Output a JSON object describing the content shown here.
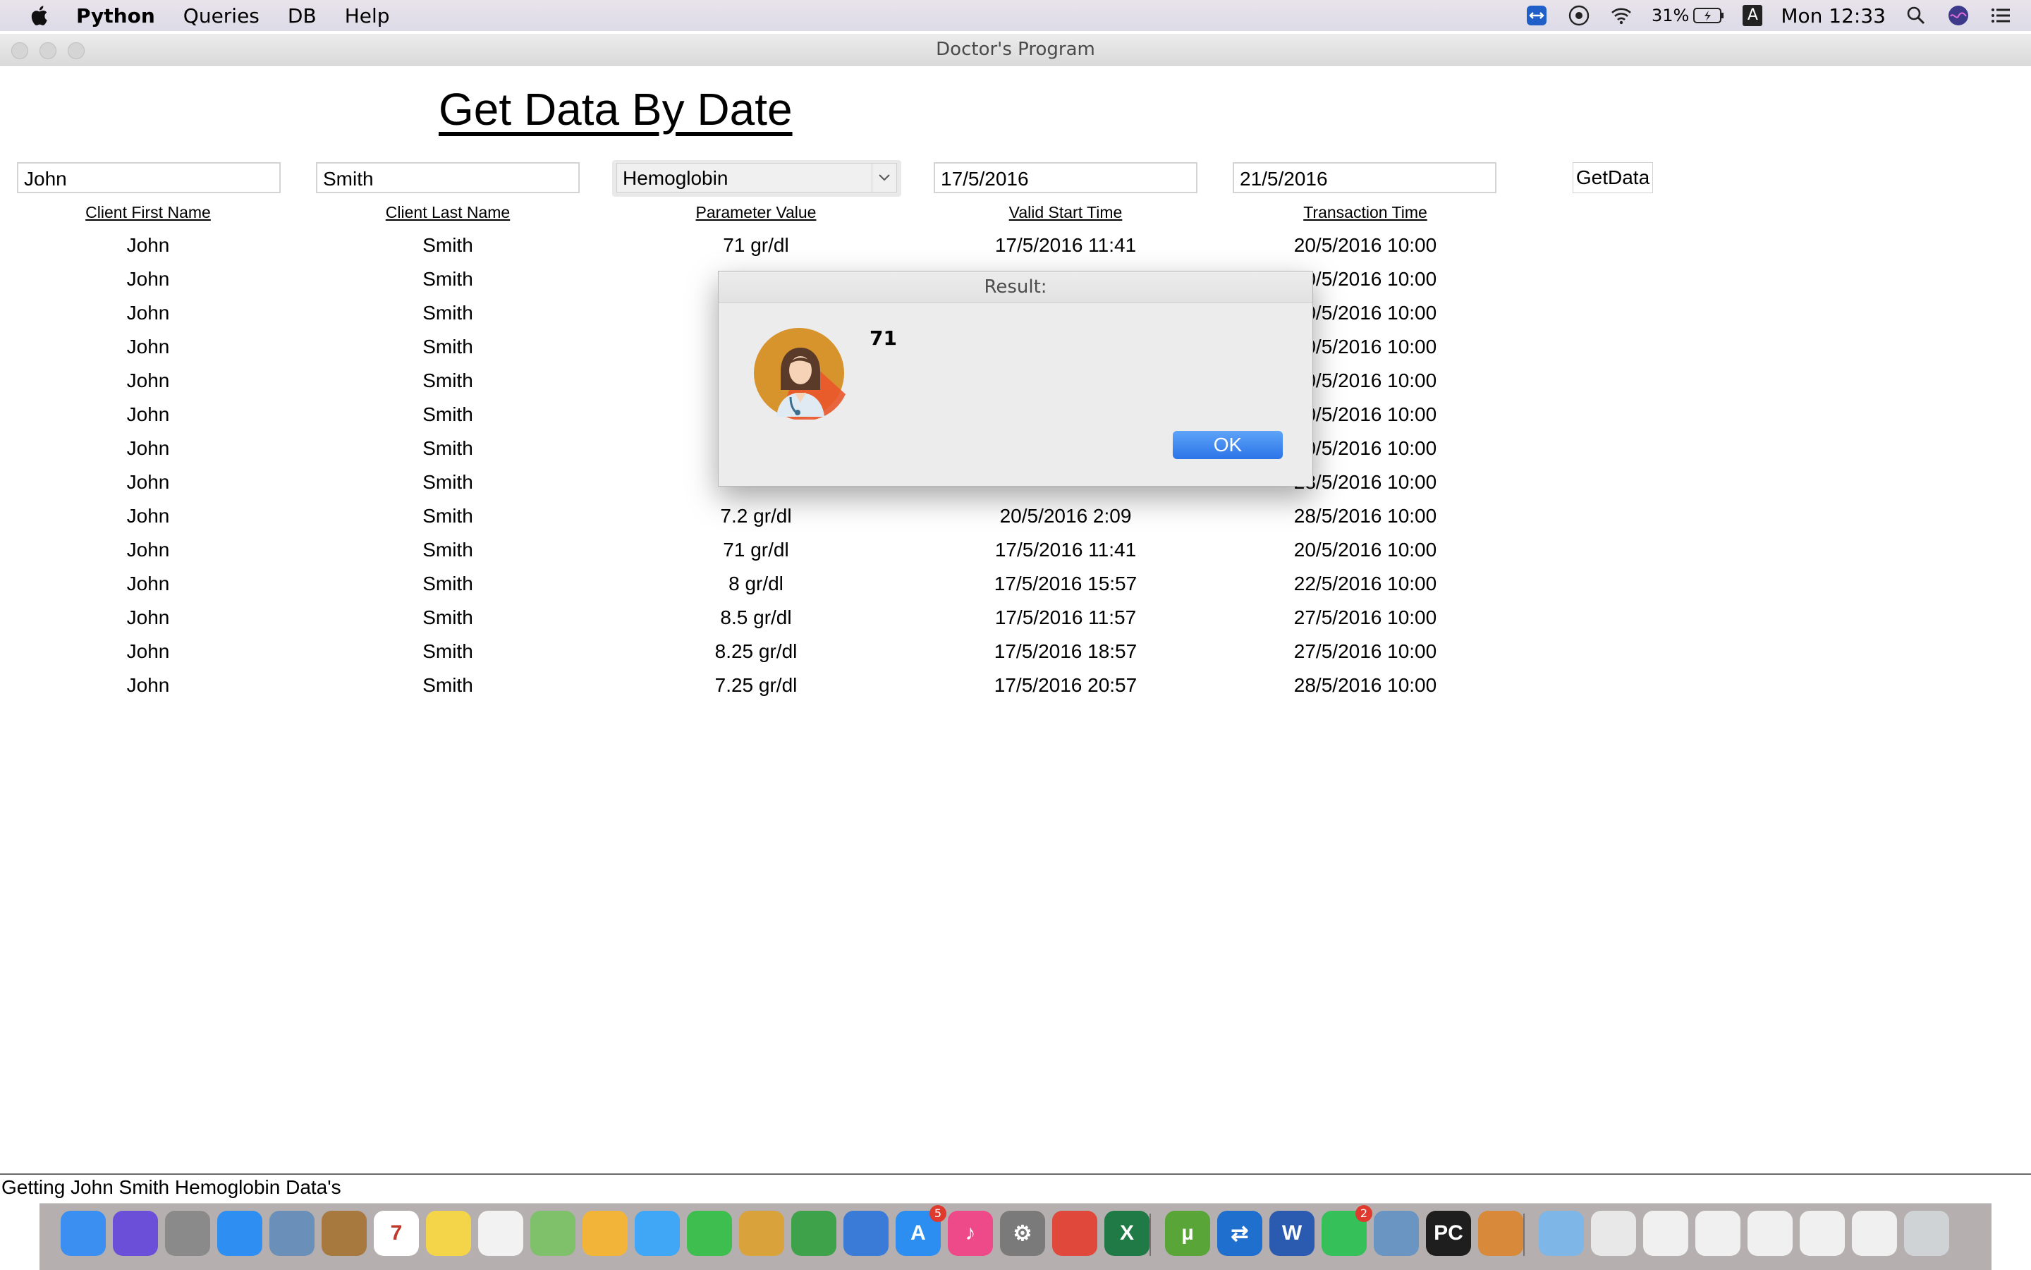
{
  "menubar": {
    "app_name": "Python",
    "items": [
      "Queries",
      "DB",
      "Help"
    ],
    "battery": "31%",
    "input_indicator": "A",
    "clock": "Mon 12:33"
  },
  "window": {
    "title": "Doctor's Program"
  },
  "page": {
    "heading": "Get Data By Date"
  },
  "form": {
    "first_name": "John",
    "last_name": "Smith",
    "parameter": "Hemoglobin",
    "start_date": "17/5/2016",
    "end_date": "21/5/2016",
    "button": "GetData"
  },
  "table": {
    "headers": [
      "Client First Name",
      "Client Last Name",
      "Parameter Value",
      "Valid Start Time",
      "Transaction Time"
    ],
    "rows": [
      [
        "John",
        "Smith",
        "71 gr/dl",
        "17/5/2016 11:41",
        "20/5/2016 10:00"
      ],
      [
        "John",
        "Smith",
        "",
        "",
        "20/5/2016 10:00"
      ],
      [
        "John",
        "Smith",
        "",
        "",
        "20/5/2016 10:00"
      ],
      [
        "John",
        "Smith",
        "",
        "",
        "20/5/2016 10:00"
      ],
      [
        "John",
        "Smith",
        "",
        "",
        "20/5/2016 10:00"
      ],
      [
        "John",
        "Smith",
        "",
        "",
        "20/5/2016 10:00"
      ],
      [
        "John",
        "Smith",
        "",
        "",
        "20/5/2016 10:00"
      ],
      [
        "John",
        "Smith",
        "",
        "",
        "28/5/2016 10:00"
      ],
      [
        "John",
        "Smith",
        "7.2 gr/dl",
        "20/5/2016 2:09",
        "28/5/2016 10:00"
      ],
      [
        "John",
        "Smith",
        "71 gr/dl",
        "17/5/2016 11:41",
        "20/5/2016 10:00"
      ],
      [
        "John",
        "Smith",
        "8 gr/dl",
        "17/5/2016 15:57",
        "22/5/2016 10:00"
      ],
      [
        "John",
        "Smith",
        "8.5 gr/dl",
        "17/5/2016 11:57",
        "27/5/2016 10:00"
      ],
      [
        "John",
        "Smith",
        "8.25 gr/dl",
        "17/5/2016 18:57",
        "27/5/2016 10:00"
      ],
      [
        "John",
        "Smith",
        "7.25 gr/dl",
        "17/5/2016 20:57",
        "28/5/2016 10:00"
      ]
    ]
  },
  "dialog": {
    "title": "Result:",
    "message": "71",
    "ok_label": "OK",
    "icon": "doctor-avatar-icon"
  },
  "status": {
    "text": "Getting John Smith Hemoglobin Data's"
  },
  "dock": {
    "apps": [
      {
        "name": "finder",
        "color": "#3b8ff0",
        "glyph": ""
      },
      {
        "name": "siri",
        "color": "#6b4fd8",
        "glyph": ""
      },
      {
        "name": "launchpad",
        "color": "#8a8a8a",
        "glyph": ""
      },
      {
        "name": "safari",
        "color": "#2f8ef2",
        "glyph": ""
      },
      {
        "name": "mail-bird",
        "color": "#6a8fb8",
        "glyph": ""
      },
      {
        "name": "contacts",
        "color": "#a8793e",
        "glyph": ""
      },
      {
        "name": "calendar",
        "color": "#ffffff",
        "glyph": "7"
      },
      {
        "name": "notes",
        "color": "#f4d54a",
        "glyph": ""
      },
      {
        "name": "reminders",
        "color": "#f2f2f2",
        "glyph": ""
      },
      {
        "name": "maps",
        "color": "#7fc06a",
        "glyph": ""
      },
      {
        "name": "photos",
        "color": "#f2b53a",
        "glyph": ""
      },
      {
        "name": "messages",
        "color": "#3fa7f5",
        "glyph": ""
      },
      {
        "name": "facetime",
        "color": "#3dbe4f",
        "glyph": ""
      },
      {
        "name": "preview",
        "color": "#d9a23a",
        "glyph": ""
      },
      {
        "name": "numbers",
        "color": "#3ea24b",
        "glyph": ""
      },
      {
        "name": "keynote",
        "color": "#3a7bd8",
        "glyph": ""
      },
      {
        "name": "app-store",
        "color": "#2b8ef0",
        "glyph": "A",
        "badge": "5"
      },
      {
        "name": "itunes",
        "color": "#ee4a8a",
        "glyph": "♪"
      },
      {
        "name": "system-preferences",
        "color": "#7a7a7a",
        "glyph": "⚙"
      },
      {
        "name": "chrome",
        "color": "#e0483b",
        "glyph": ""
      },
      {
        "name": "excel",
        "color": "#1f7a45",
        "glyph": "X"
      },
      {
        "name": "utorrent",
        "color": "#5aa537",
        "glyph": "µ"
      },
      {
        "name": "teamviewer",
        "color": "#1f6fcf",
        "glyph": "⇄"
      },
      {
        "name": "word",
        "color": "#2b5bb0",
        "glyph": "W"
      },
      {
        "name": "whatsapp",
        "color": "#36c05a",
        "glyph": "",
        "badge": "2"
      },
      {
        "name": "image-capture",
        "color": "#6a95c2",
        "glyph": ""
      },
      {
        "name": "pycharm",
        "color": "#1e1e1e",
        "glyph": "PC"
      },
      {
        "name": "doctor-program",
        "color": "#d88a3a",
        "glyph": ""
      },
      {
        "name": "downloads-folder",
        "color": "#7fb6e8",
        "glyph": ""
      },
      {
        "name": "document-stack",
        "color": "#e8e8e8",
        "glyph": ""
      },
      {
        "name": "recent-window-1",
        "color": "#f0f0f0",
        "glyph": ""
      },
      {
        "name": "recent-window-2",
        "color": "#f0f0f0",
        "glyph": ""
      },
      {
        "name": "recent-window-3",
        "color": "#f0f0f0",
        "glyph": ""
      },
      {
        "name": "recent-window-4",
        "color": "#f0f0f0",
        "glyph": ""
      },
      {
        "name": "recent-window-5",
        "color": "#f0f0f0",
        "glyph": ""
      },
      {
        "name": "trash",
        "color": "#cfd3d6",
        "glyph": ""
      }
    ]
  }
}
